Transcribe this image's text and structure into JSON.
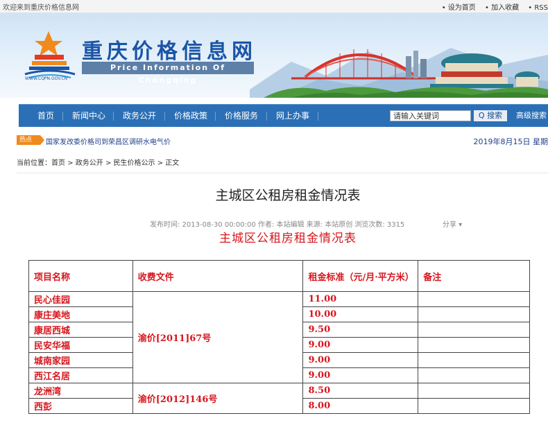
{
  "topbar": {
    "welcome": "欢迎来到重庆价格信息网",
    "set_home": "• 设为首页",
    "favorite": "• 加入收藏",
    "rss": "• RSS"
  },
  "logo": {
    "title": "重庆价格信息网",
    "subtitle": "Price Information Of Chongqing",
    "url": "WWW.CQPN.GOV.CN"
  },
  "nav": {
    "items": [
      "首页",
      "新闻中心",
      "政务公开",
      "价格政策",
      "价格服务",
      "网上办事"
    ],
    "search_placeholder": "请输入关键词",
    "search_button": "Q 搜索",
    "advanced_search": "高级搜索"
  },
  "hotbar": {
    "badge": "热点",
    "news": "国家发改委价格司到荣昌区调研水电气价",
    "date": "2019年8月15日 星期"
  },
  "breadcrumb": {
    "prefix": "当前位置：",
    "items": [
      "首页",
      "政务公开",
      "民生价格公示",
      "正文"
    ],
    "separator": ">"
  },
  "article": {
    "title": "主城区公租房租金情况表",
    "meta": "发布时间:  2013-08-30 00:00:00   作者: 本站编辑   来源: 本站原创   浏览次数: 3315",
    "share": "分享 ▾",
    "doc_title": "主城区公租房租金情况表"
  },
  "table": {
    "headers": [
      "项目名称",
      "收费文件",
      "租金标准（元/月·平方米）",
      "备注"
    ],
    "groups": [
      {
        "file": "渝价[2011]67号",
        "rows": [
          {
            "name": "民心佳园",
            "rent": "11.00",
            "note": ""
          },
          {
            "name": "康庄美地",
            "rent": "10.00",
            "note": ""
          },
          {
            "name": "康居西城",
            "rent": "9.50",
            "note": ""
          },
          {
            "name": "民安华福",
            "rent": "9.00",
            "note": ""
          },
          {
            "name": "城南家园",
            "rent": "9.00",
            "note": ""
          },
          {
            "name": "西江名居",
            "rent": "9.00",
            "note": ""
          }
        ]
      },
      {
        "file": "渝价[2012]146号",
        "rows": [
          {
            "name": "龙洲湾",
            "rent": "8.50",
            "note": ""
          },
          {
            "name": "西彭",
            "rent": "8.00",
            "note": ""
          }
        ]
      }
    ]
  }
}
